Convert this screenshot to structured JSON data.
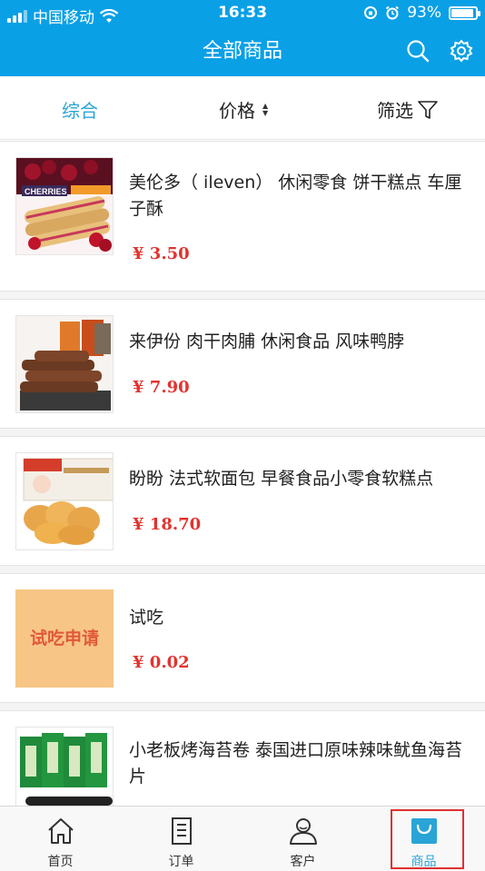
{
  "status_bar": {
    "carrier": "中国移动",
    "time": "16:33",
    "battery_percent": "93%",
    "battery_level": 0.93
  },
  "header": {
    "title": "全部商品",
    "search_icon": "search-icon",
    "settings_icon": "gear-icon"
  },
  "filter_bar": {
    "overall": "综合",
    "price": "价格",
    "filter": "筛选"
  },
  "products": [
    {
      "name": "美伦多（ ileven） 休闲零食 饼干糕点 车厘子酥",
      "price": "¥ 3.50",
      "thumb_label": "CHERRIES"
    },
    {
      "name": "来伊份 肉干肉脯 休闲食品 风味鸭脖",
      "price": "¥ 7.90"
    },
    {
      "name": "盼盼 法式软面包 早餐食品小零食软糕点",
      "price": "¥ 18.70"
    },
    {
      "name": "试吃",
      "price": "¥ 0.02",
      "thumb_label": "试吃申请"
    },
    {
      "name": "小老板烤海苔卷 泰国进口原味辣味鱿鱼海苔片",
      "price": ""
    }
  ],
  "tabbar": {
    "tabs": [
      {
        "label": "首页",
        "icon": "home-icon"
      },
      {
        "label": "订单",
        "icon": "order-icon"
      },
      {
        "label": "客户",
        "icon": "user-icon"
      },
      {
        "label": "商品",
        "icon": "bag-icon"
      }
    ]
  },
  "colors": {
    "brand": "#0aa0e6",
    "price": "#e2332f",
    "active": "#2aa4d6"
  }
}
